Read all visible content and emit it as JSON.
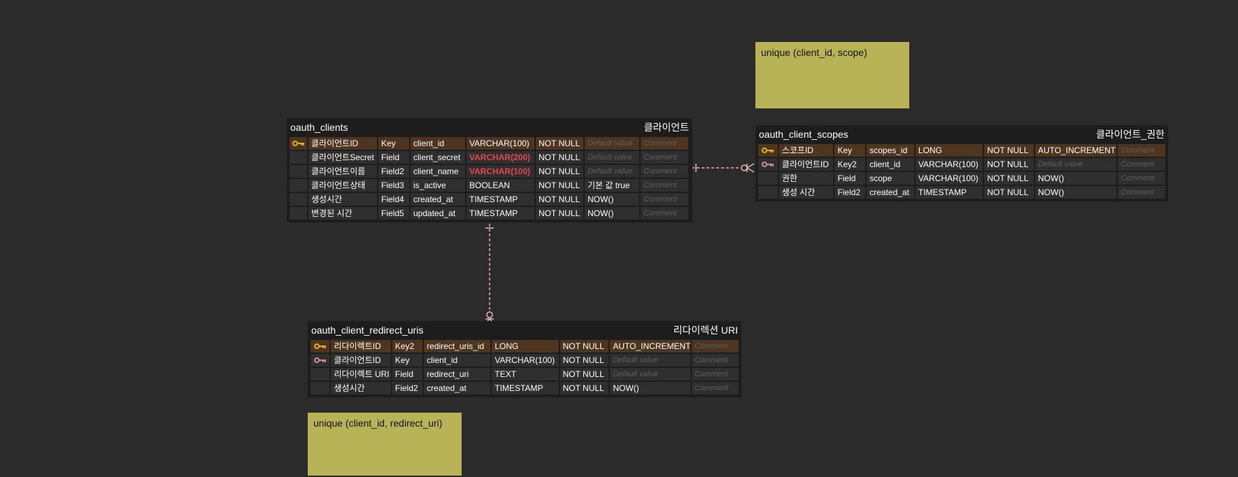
{
  "memos": [
    {
      "id": "memo1",
      "text": "unique (client_id, scope)"
    },
    {
      "id": "memo2",
      "text": "unique (client_id, redirect_uri)"
    }
  ],
  "tables": {
    "oauth_clients": {
      "name": "oauth_clients",
      "comment": "클라이언트",
      "rows": [
        {
          "key_icon": "primary-key-icon",
          "logical": "클라이언트ID",
          "domain": "Key",
          "physical": "client_id",
          "type": "VARCHAR(100)",
          "null": "NOT NULL",
          "default": "Default value",
          "comment": "Comment"
        },
        {
          "key_icon": "",
          "logical": "클라이언트Secret",
          "domain": "Field",
          "physical": "client_secret",
          "type": "VARCHAR(200)",
          "null": "NOT NULL",
          "default": "Default value",
          "comment": "Comment"
        },
        {
          "key_icon": "",
          "logical": "클라이언트이름",
          "domain": "Field2",
          "physical": "client_name",
          "type": "VARCHAR(100)",
          "null": "NOT NULL",
          "default": "Default value",
          "comment": "Comment"
        },
        {
          "key_icon": "",
          "logical": "클라이언트상태",
          "domain": "Field3",
          "physical": "is_active",
          "type": "BOOLEAN",
          "null": "NOT NULL",
          "default": "기본 값 true",
          "comment": "Comment"
        },
        {
          "key_icon": "",
          "logical": "생성시간",
          "domain": "Field4",
          "physical": "created_at",
          "type": "TIMESTAMP",
          "null": "NOT NULL",
          "default": "NOW()",
          "comment": "Comment"
        },
        {
          "key_icon": "",
          "logical": "변경된 시간",
          "domain": "Field5",
          "physical": "updated_at",
          "type": "TIMESTAMP",
          "null": "NOT NULL",
          "default": "NOW()",
          "comment": "Comment"
        }
      ]
    },
    "oauth_client_scopes": {
      "name": "oauth_client_scopes",
      "comment": "클라이언트_권한",
      "rows": [
        {
          "key_icon": "primary-key-icon",
          "logical": "스코프ID",
          "domain": "Key",
          "physical": "scopes_id",
          "type": "LONG",
          "null": "NOT NULL",
          "default": "AUTO_INCREMENT",
          "comment": "Comment"
        },
        {
          "key_icon": "foreign-key-icon",
          "logical": "클라이언트ID",
          "domain": "Key2",
          "physical": "client_id",
          "type": "VARCHAR(100)",
          "null": "NOT NULL",
          "default": "Default value",
          "comment": "Comment"
        },
        {
          "key_icon": "",
          "logical": "권한",
          "domain": "Field",
          "physical": "scope",
          "type": "VARCHAR(100)",
          "null": "NOT NULL",
          "default": "NOW()",
          "comment": "Comment"
        },
        {
          "key_icon": "",
          "logical": "생성 시간",
          "domain": "Field2",
          "physical": "created_at",
          "type": "TIMESTAMP",
          "null": "NOT NULL",
          "default": "NOW()",
          "comment": "Comment"
        }
      ]
    },
    "oauth_client_redirect_uris": {
      "name": "oauth_client_redirect_uris",
      "comment": "리다이렉션 URI",
      "rows": [
        {
          "key_icon": "primary-key-icon",
          "logical": "리다이렉트ID",
          "domain": "Key2",
          "physical": "redirect_uris_id",
          "type": "LONG",
          "null": "NOT NULL",
          "default": "AUTO_INCREMENT",
          "comment": "Comment"
        },
        {
          "key_icon": "foreign-key-icon",
          "logical": "클라이언트ID",
          "domain": "Key",
          "physical": "client_id",
          "type": "VARCHAR(100)",
          "null": "NOT NULL",
          "default": "Default value",
          "comment": "Comment"
        },
        {
          "key_icon": "",
          "logical": "리다이렉트 URI",
          "domain": "Field",
          "physical": "redirect_uri",
          "type": "TEXT",
          "null": "NOT NULL",
          "default": "Default value",
          "comment": "Comment"
        },
        {
          "key_icon": "",
          "logical": "생성시간",
          "domain": "Field2",
          "physical": "created_at",
          "type": "TIMESTAMP",
          "null": "NOT NULL",
          "default": "NOW()",
          "comment": "Comment"
        }
      ]
    }
  },
  "colors": {
    "background": "#2b2b2b",
    "table_bg": "#1d1d1d",
    "cell_bg": "#2f2f2f",
    "pk_row_bg": "#4e3520",
    "memo_bg": "#b8b357",
    "relation_line": "#e8b4b8",
    "primary_key_icon": "#e0b21c",
    "foreign_key_icon": "#c98f98",
    "size_warning_text": "#e2474f"
  }
}
